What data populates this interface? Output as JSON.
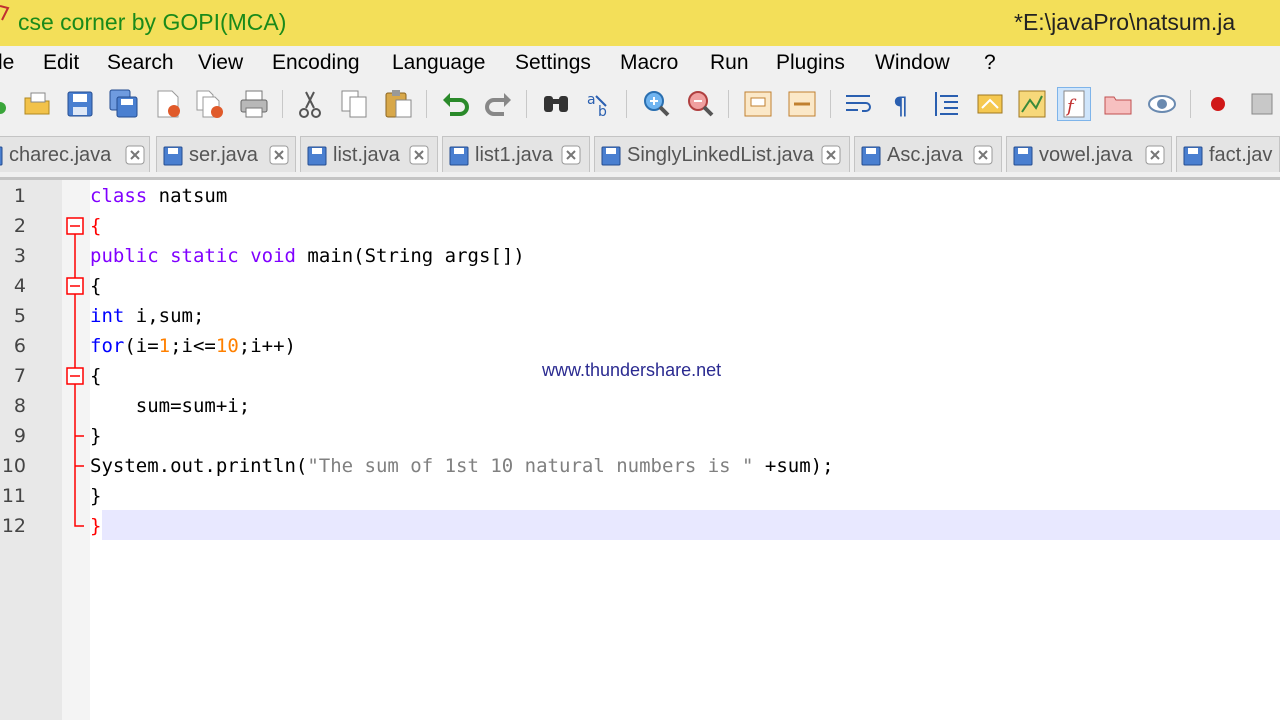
{
  "window": {
    "left_title": "cse corner by GOPI(MCA)",
    "right_title": "*E:\\javaPro\\natsum.ja"
  },
  "menu": [
    "le",
    "Edit",
    "Search",
    "View",
    "Encoding",
    "Language",
    "Settings",
    "Macro",
    "Run",
    "Plugins",
    "Window",
    "?"
  ],
  "tabs": [
    {
      "label": "charec.java"
    },
    {
      "label": "ser.java"
    },
    {
      "label": "list.java"
    },
    {
      "label": "list1.java"
    },
    {
      "label": "SinglyLinkedList.java"
    },
    {
      "label": "Asc.java"
    },
    {
      "label": "vowel.java"
    },
    {
      "label": "fact.jav"
    }
  ],
  "editor": {
    "line_numbers": [
      "1",
      "2",
      "3",
      "4",
      "5",
      "6",
      "7",
      "8",
      "9",
      "10",
      "11",
      "12"
    ],
    "watermark": "www.thundershare.net",
    "code": {
      "l1_kw": "class",
      "l1_rest": " natsum",
      "l2": "{",
      "l3_kw1": "public",
      "l3_kw2": "static",
      "l3_kw3": "void",
      "l3_rest": " main(String args[])",
      "l4": "{",
      "l5_kw": "int",
      "l5_rest": " i,sum;",
      "l6_kw": "for",
      "l6_a": "(i=",
      "l6_n1": "1",
      "l6_b": ";i<=",
      "l6_n2": "10",
      "l6_c": ";i++)",
      "l7": "{",
      "l8": "    sum=sum+i;",
      "l9": "}",
      "l10_a": "System.out.println(",
      "l10_str": "\"The sum of 1st 10 natural numbers is \"",
      "l10_b": " +sum);",
      "l11": "}",
      "l12": "}"
    }
  },
  "cursor_glyph": "I",
  "colors": {
    "title_bg": "#f3df59",
    "title_text": "#1a8a1a",
    "keyword": "#8000ff",
    "keyword_type": "#0000ff",
    "number": "#ff8000",
    "string": "#808080",
    "fold_line": "#ff0000",
    "current_line": "#e8e8ff"
  },
  "icons": [
    "app-icon",
    "new-file-icon",
    "open-file-icon",
    "save-icon",
    "save-all-icon",
    "close-icon",
    "close-all-icon",
    "print-icon",
    "cut-icon",
    "copy-icon",
    "paste-icon",
    "undo-icon",
    "redo-icon",
    "find-icon",
    "replace-icon",
    "zoom-in-icon",
    "zoom-out-icon",
    "sync-vertical-icon",
    "sync-horizontal-icon",
    "word-wrap-icon",
    "show-all-chars-icon",
    "indent-guide-icon",
    "user-language-icon",
    "doc-map-icon",
    "function-list-icon",
    "folder-workspace-icon",
    "monitor-icon",
    "record-macro-icon",
    "stop-macro-icon"
  ]
}
